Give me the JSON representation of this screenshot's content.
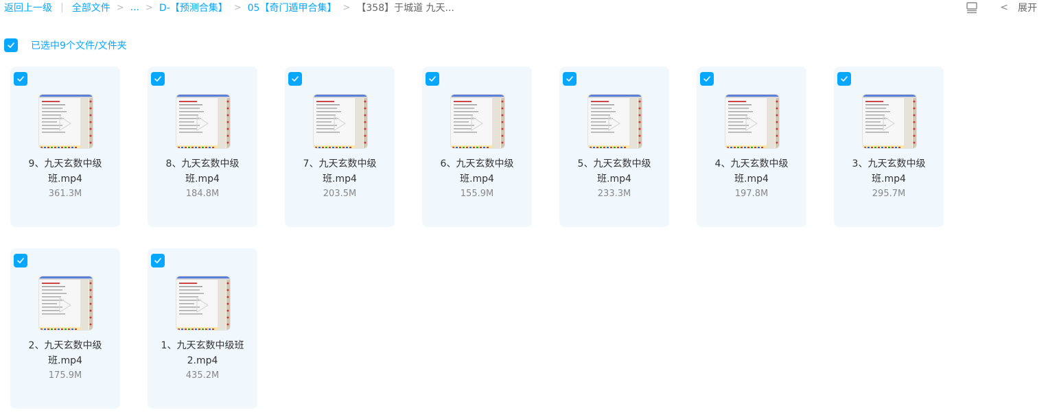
{
  "breadcrumb": {
    "back": "返回上一级",
    "separator": "|",
    "items": [
      "全部文件",
      "...",
      "D-【预测合集】",
      "05【奇门遁甲合集】",
      "【358】于城道 九天..."
    ]
  },
  "toolbar": {
    "list_view_icon": "list-view-icon",
    "expand_label": "展开"
  },
  "selection": {
    "label": "已选中9个文件/文件夹"
  },
  "colors": {
    "accent": "#06a7ff",
    "card_bg": "#f0f8fd"
  },
  "files": [
    {
      "name": "9、九天玄数中级班.mp4",
      "size": "361.3M"
    },
    {
      "name": "8、九天玄数中级班.mp4",
      "size": "184.8M"
    },
    {
      "name": "7、九天玄数中级班.mp4",
      "size": "203.5M"
    },
    {
      "name": "6、九天玄数中级班.mp4",
      "size": "155.9M"
    },
    {
      "name": "5、九天玄数中级班.mp4",
      "size": "233.3M"
    },
    {
      "name": "4、九天玄数中级班.mp4",
      "size": "197.8M"
    },
    {
      "name": "3、九天玄数中级班.mp4",
      "size": "295.7M"
    },
    {
      "name": "2、九天玄数中级班.mp4",
      "size": "175.9M"
    },
    {
      "name": "1、九天玄数中级班2.mp4",
      "size": "435.2M"
    }
  ]
}
